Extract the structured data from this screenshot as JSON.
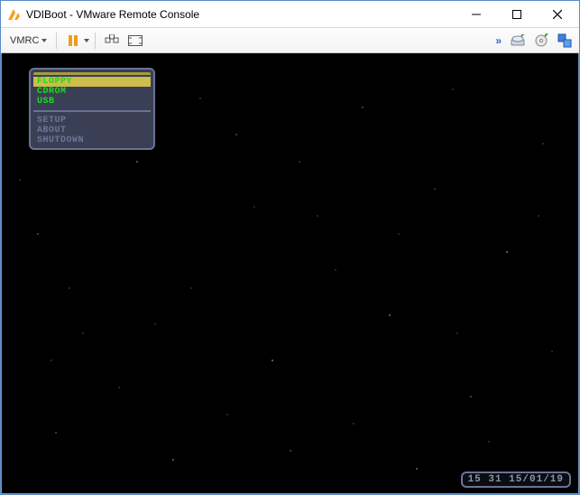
{
  "window": {
    "title": "VDIBoot - VMware Remote Console"
  },
  "toolbar": {
    "menu_label": "VMRC"
  },
  "boot_menu": {
    "group1": [
      {
        "label": "FLOPPY",
        "selected": true
      },
      {
        "label": "CDROM",
        "selected": false
      },
      {
        "label": "USB",
        "selected": false
      }
    ],
    "group2": [
      {
        "label": "SETUP"
      },
      {
        "label": "ABOUT"
      },
      {
        "label": "SHUTDOWN"
      }
    ]
  },
  "clock": {
    "text": "15 31 15/01/19"
  }
}
